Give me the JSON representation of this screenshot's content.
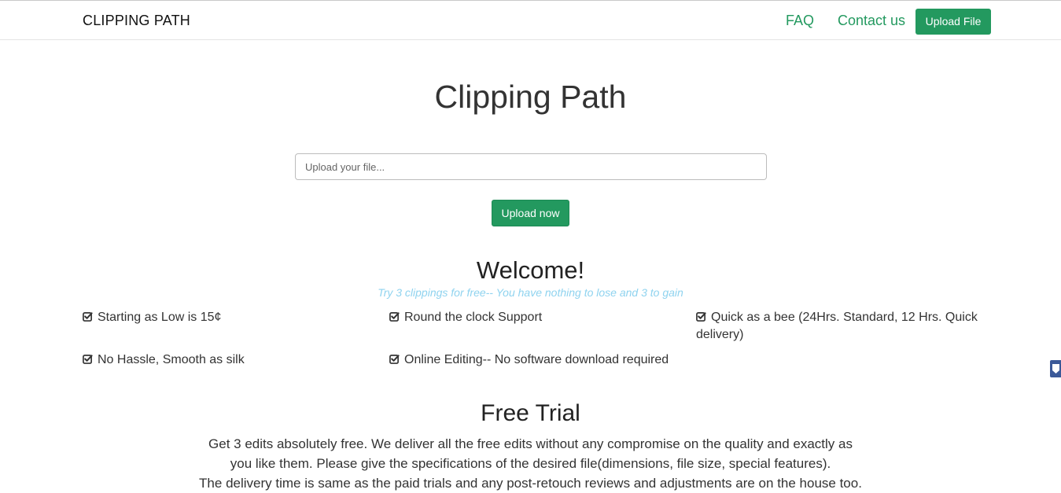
{
  "navbar": {
    "brand": "CLIPPING PATH",
    "links": [
      "FAQ",
      "Contact us"
    ],
    "upload_button": "Upload File"
  },
  "hero": {
    "title": "Clipping Path",
    "upload_placeholder": "Upload your file...",
    "upload_button": "Upload now"
  },
  "welcome": {
    "title": "Welcome!",
    "subtitle": "Try 3 clippings for free-- You have nothing to lose and 3 to gain",
    "features": [
      "Starting as Low is 15¢",
      "Round the clock Support",
      "Quick as a bee (24Hrs. Standard, 12 Hrs. Quick delivery)",
      "No Hassle, Smooth as silk",
      "Online Editing-- No software download required"
    ]
  },
  "free_trial": {
    "title": "Free Trial",
    "lines": [
      "Get 3 edits absolutely free. We deliver all the free edits without any compromise on the quality and exactly as",
      "you like them. Please give the specifications of the desired file(dimensions, file size, special features).",
      "The delivery time is same as the paid trials and any post-retouch reviews and adjustments are on the house too."
    ]
  },
  "colors": {
    "accent_green": "#23995f",
    "subtitle_blue": "#8fd3ef",
    "side_tab_blue": "#3b5998"
  },
  "icons": {
    "feature_icon": "check-square-icon",
    "side_tab_icon": "chevron-down-icon"
  }
}
